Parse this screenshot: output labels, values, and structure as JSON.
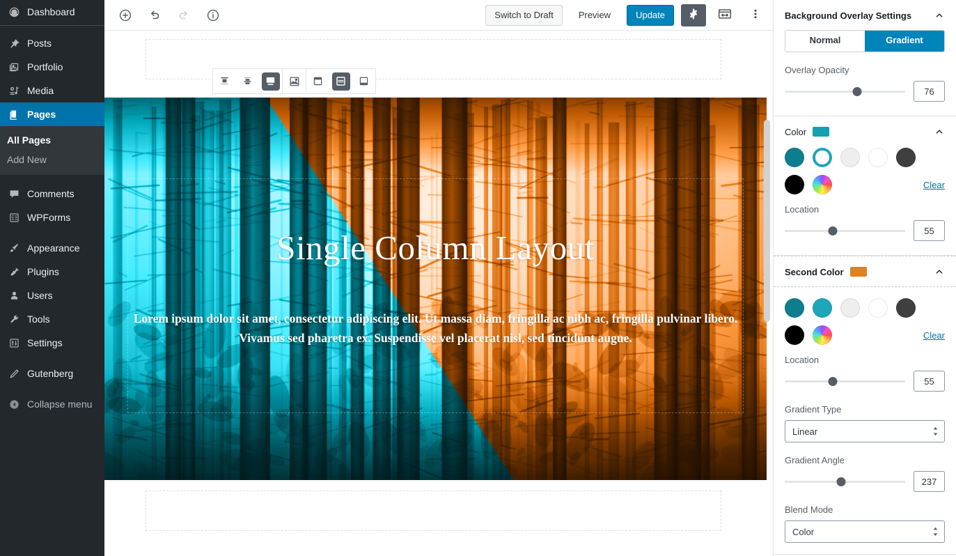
{
  "admin_menu": {
    "items": [
      {
        "label": "Dashboard",
        "icon": "dashboard-icon",
        "current": false
      },
      {
        "label": "Posts",
        "icon": "pin-icon",
        "current": false
      },
      {
        "label": "Portfolio",
        "icon": "portfolio-icon",
        "current": false
      },
      {
        "label": "Media",
        "icon": "media-icon",
        "current": false
      },
      {
        "label": "Pages",
        "icon": "pages-icon",
        "current": true
      },
      {
        "label": "Comments",
        "icon": "comments-icon",
        "current": false
      },
      {
        "label": "WPForms",
        "icon": "wpforms-icon",
        "current": false
      },
      {
        "label": "Appearance",
        "icon": "appearance-brush-icon",
        "current": false
      },
      {
        "label": "Plugins",
        "icon": "plugins-plug-icon",
        "current": false
      },
      {
        "label": "Users",
        "icon": "users-icon",
        "current": false
      },
      {
        "label": "Tools",
        "icon": "tools-wrench-icon",
        "current": false
      },
      {
        "label": "Settings",
        "icon": "settings-sliders-icon",
        "current": false
      },
      {
        "label": "Gutenberg",
        "icon": "pencil-icon",
        "current": false
      }
    ],
    "submenu": [
      {
        "label": "All Pages",
        "current": true
      },
      {
        "label": "Add New",
        "current": false
      }
    ],
    "collapse_label": "Collapse menu",
    "collapse_icon": "collapse-arrow-icon",
    "highlight_color": "#0073aa",
    "background_color": "#23282d",
    "submenu_background": "#32373c"
  },
  "header": {
    "left_tools": [
      {
        "name": "add-block-button",
        "icon": "plus-circle-icon",
        "disabled": false
      },
      {
        "name": "undo-button",
        "icon": "undo-arrow-icon",
        "disabled": false
      },
      {
        "name": "redo-button",
        "icon": "redo-arrow-icon",
        "disabled": true
      },
      {
        "name": "content-info-button",
        "icon": "info-circle-icon",
        "disabled": false
      }
    ],
    "switch_to_draft_label": "Switch to Draft",
    "preview_label": "Preview",
    "update_label": "Update",
    "settings_gear_icon": "gear-icon",
    "block-navigation_icon": "sidebar-toggle-icon",
    "more_menu_icon": "ellipsis-vertical-icon",
    "primary_color": "#0085ba"
  },
  "block_toolbar": {
    "groups": [
      {
        "name": "vertical-alignment",
        "buttons": [
          {
            "name": "align-top-button",
            "icon": "vertical-align-top-icon",
            "active": false
          },
          {
            "name": "align-middle-button",
            "icon": "vertical-align-center-icon",
            "active": false
          },
          {
            "name": "align-bottom-button",
            "icon": "vertical-align-bottom-icon",
            "active": true
          }
        ]
      },
      {
        "name": "media-options",
        "buttons": [
          {
            "name": "edit-media-button",
            "icon": "image-icon",
            "active": false
          }
        ]
      },
      {
        "name": "content-position",
        "buttons": [
          {
            "name": "content-position-top-button",
            "icon": "content-top-icon",
            "active": false
          },
          {
            "name": "content-position-center-button",
            "icon": "content-center-icon",
            "active": true
          },
          {
            "name": "content-position-bottom-button",
            "icon": "content-bottom-icon",
            "active": false
          }
        ]
      }
    ]
  },
  "cover_block": {
    "title": "Single Column Layout",
    "paragraph": "Lorem ipsum dolor sit amet, consectetur adipiscing elit. Ut massa diam, fringilla ac nibh ac, fringilla pulvinar libero. Vivamus sed pharetra ex. Suspendisse vel placerat nisl, sed tincidunt augue.",
    "overlay_color_a": "#e8832a",
    "overlay_color_b": "#1ec6da",
    "gradient_angle_deg": 237
  },
  "inspector": {
    "background_overlay": {
      "title": "Background Overlay Settings",
      "collapse_icon": "chevron-up-icon",
      "tabs": [
        {
          "label": "Normal",
          "active": false
        },
        {
          "label": "Gradient",
          "active": true
        }
      ],
      "overlay_opacity": {
        "label": "Overlay Opacity",
        "value": "76",
        "percent": 76
      }
    },
    "color_panel": {
      "title": "Color",
      "swatch_color": "#15a0ae",
      "collapse_icon": "chevron-up-icon",
      "swatches": [
        {
          "name": "swatch-teal-dark",
          "color": "#0e7e8f",
          "selected": false
        },
        {
          "name": "swatch-teal",
          "color": "#1fa6b8",
          "selected": true
        },
        {
          "name": "swatch-light-gray",
          "color": "#eeeeee",
          "selected": false
        },
        {
          "name": "swatch-white",
          "color": "#ffffff",
          "selected": false
        },
        {
          "name": "swatch-dark-gray",
          "color": "#3f3f3f",
          "selected": false
        },
        {
          "name": "swatch-black",
          "color": "#000000",
          "selected": false
        },
        {
          "name": "swatch-custom-color-picker",
          "color": "rainbow",
          "selected": false
        }
      ],
      "clear_label": "Clear",
      "location": {
        "label": "Location",
        "value": "55",
        "percent": 40
      }
    },
    "second_color_panel": {
      "title": "Second Color",
      "swatch_color": "#e2801e",
      "collapse_icon": "chevron-up-icon",
      "swatches": [
        {
          "name": "swatch-teal-dark",
          "color": "#0e7e8f",
          "selected": false
        },
        {
          "name": "swatch-teal",
          "color": "#1fa6b8",
          "selected": false
        },
        {
          "name": "swatch-light-gray",
          "color": "#eeeeee",
          "selected": false
        },
        {
          "name": "swatch-white",
          "color": "#ffffff",
          "selected": false
        },
        {
          "name": "swatch-dark-gray",
          "color": "#3f3f3f",
          "selected": false
        },
        {
          "name": "swatch-black",
          "color": "#000000",
          "selected": false
        },
        {
          "name": "swatch-custom-color-picker",
          "color": "rainbow",
          "selected": false
        }
      ],
      "clear_label": "Clear",
      "location": {
        "label": "Location",
        "value": "55",
        "percent": 40
      },
      "gradient_type": {
        "label": "Gradient Type",
        "value": "Linear"
      },
      "gradient_angle": {
        "label": "Gradient Angle",
        "value": "237",
        "percent": 47
      },
      "blend_mode": {
        "label": "Blend Mode",
        "value": "Color"
      }
    }
  }
}
